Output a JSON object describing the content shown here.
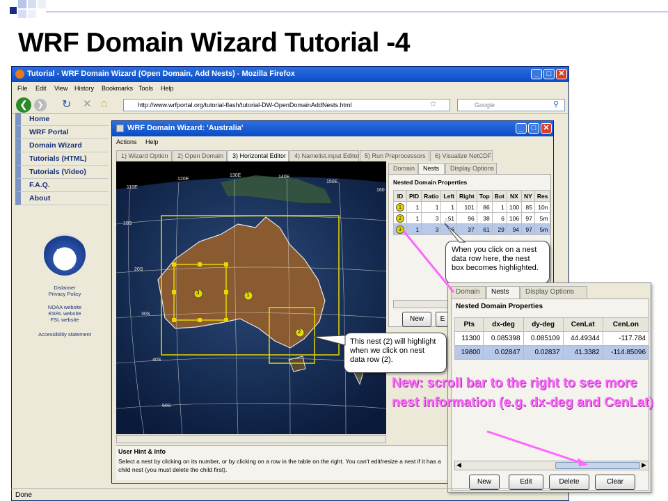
{
  "slide": {
    "title": "WRF Domain Wizard Tutorial -4"
  },
  "browser": {
    "title": "Tutorial - WRF Domain Wizard (Open Domain, Add Nests) - Mozilla Firefox",
    "menu": [
      "File",
      "Edit",
      "View",
      "History",
      "Bookmarks",
      "Tools",
      "Help"
    ],
    "url": "http://www.wrfportal.org/tutorial-flash/tutorial-DW-OpenDomainAddNests.html",
    "search_placeholder": "Google",
    "status": "Done"
  },
  "site_nav": {
    "items": [
      "Home",
      "WRF Portal",
      "Domain Wizard",
      "Tutorials (HTML)",
      "Tutorials (Video)",
      "F.A.Q.",
      "About"
    ],
    "logo": "NOAA",
    "footer": [
      "Dislaimer",
      "Privacy Policy",
      "NOAA website",
      "ESRL website",
      "FSL website",
      "Accessibility statement"
    ]
  },
  "wizard": {
    "title": "WRF Domain Wizard: 'Australia'",
    "menu": [
      "Actions",
      "Help"
    ],
    "tabs": [
      "1) Wizard Option",
      "2) Open Domain",
      "3) Horizontal Editor",
      "4) Namelist.input Editor",
      "5) Run Preprocessors",
      "6) Visualize NetCDF"
    ],
    "active_tab": "3) Horizontal Editor",
    "map_labels": {
      "lon": [
        "110E",
        "120E",
        "130E",
        "140E",
        "150E",
        "160"
      ],
      "lat": [
        "10S",
        "20S",
        "30S",
        "40S",
        "50S"
      ],
      "nest_markers": [
        "1",
        "2",
        "3"
      ]
    },
    "right_tabs": [
      "Domain",
      "Nests",
      "Display Options"
    ],
    "active_right_tab": "Nests",
    "nested_title": "Nested Domain Properties",
    "small_table": {
      "headers": [
        "ID",
        "PID",
        "Ratio",
        "Left",
        "Right",
        "Top",
        "Bot",
        "NX",
        "NY",
        "Res"
      ],
      "rows": [
        [
          "1",
          "1",
          "1",
          "1",
          "101",
          "86",
          "1",
          "100",
          "85",
          "10n"
        ],
        [
          "2",
          "1",
          "3",
          "61",
          "96",
          "38",
          "6",
          "106",
          "97",
          "5m"
        ],
        [
          "3",
          "1",
          "3",
          "6",
          "37",
          "61",
          "29",
          "94",
          "97",
          "5m"
        ]
      ]
    },
    "small_buttons": [
      "New",
      "E"
    ],
    "hint_title": "User Hint & Info",
    "hint_text": "Select a nest by clicking on its number, or by clicking on a row in the table on the right. You can't edit/resize a nest if it has a child nest (you must delete the child first)."
  },
  "zoom_panel": {
    "tabs": [
      "Domain",
      "Nests",
      "Display Options"
    ],
    "title": "Nested Domain Properties",
    "headers": [
      "Pts",
      "dx-deg",
      "dy-deg",
      "CenLat",
      "CenLon"
    ],
    "rows": [
      [
        "11300",
        "0.085398",
        "0.085109",
        "44.49344",
        "-117.784"
      ],
      [
        "19800",
        "0.02847",
        "0.02837",
        "41.3382",
        "-114.85096"
      ]
    ],
    "buttons": [
      "New",
      "Edit",
      "Delete",
      "Clear"
    ]
  },
  "callouts": {
    "row": "When you click on a nest data row here, the nest box becomes highlighted.",
    "nest": "This nest (2) will highlight when we click on nest data row (2)."
  },
  "note": "New: scroll bar to the right to see more nest information (e.g. dx-deg and CenLat)",
  "colors": {
    "accent_pink": "#ff66ff",
    "title_blue": "#0a4cc4",
    "nest_yellow": "#e8d800"
  }
}
